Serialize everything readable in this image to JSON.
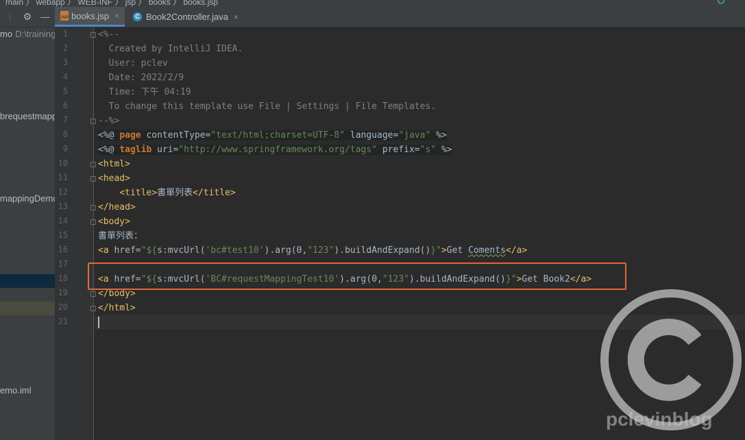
{
  "breadcrumb": [
    "main",
    "webapp",
    "WEB-INF",
    "jsp",
    "books",
    "books.jsp"
  ],
  "project_panel": {
    "items": [
      {
        "label": "mo",
        "path": "D:\\training"
      },
      {
        "label": "brequestmapp",
        "path": ""
      },
      {
        "label": "mappingDemo",
        "path": ""
      },
      {
        "label": "emo.iml",
        "path": ""
      }
    ]
  },
  "tabs": [
    {
      "label": "books.jsp",
      "icon": "jsp-file-icon",
      "active": true
    },
    {
      "label": "Book2Controller.java",
      "icon": "java-class-icon",
      "active": false
    }
  ],
  "tab_icons": {
    "jsp": "JSP",
    "class": "C"
  },
  "close_glyph": "×",
  "editor": {
    "caret_line": 21,
    "line_numbers": [
      "1",
      "2",
      "3",
      "4",
      "5",
      "6",
      "7",
      "8",
      "9",
      "10",
      "11",
      "12",
      "13",
      "14",
      "15",
      "16",
      "17",
      "18",
      "19",
      "20",
      "21"
    ],
    "lines": [
      [
        [
          "c",
          "<%--"
        ]
      ],
      [
        [
          "c",
          "  Created by IntelliJ IDEA."
        ]
      ],
      [
        [
          "c",
          "  User: pclev"
        ]
      ],
      [
        [
          "c",
          "  Date: 2022/2/9"
        ]
      ],
      [
        [
          "c",
          "  Time: 下午 04:19"
        ]
      ],
      [
        [
          "c",
          "  To change this template use File | Settings | File Templates."
        ]
      ],
      [
        [
          "c",
          "--%>"
        ]
      ],
      [
        [
          "dir",
          "<%@ "
        ],
        [
          "kwd",
          "page"
        ],
        [
          "dir",
          " contentType="
        ],
        [
          "str",
          "\"text/html;charset=UTF-8\""
        ],
        [
          "dir",
          " language="
        ],
        [
          "str",
          "\"java\""
        ],
        [
          "dir",
          " %>"
        ]
      ],
      [
        [
          "dir",
          "<%@ "
        ],
        [
          "kwd",
          "taglib"
        ],
        [
          "dir",
          " uri="
        ],
        [
          "str",
          "\"http://www.springframework.org/tags\""
        ],
        [
          "dir",
          " prefix="
        ],
        [
          "str",
          "\"s\""
        ],
        [
          "dir",
          " %>"
        ]
      ],
      [
        [
          "tag",
          "<html>"
        ]
      ],
      [
        [
          "tag",
          "<head>"
        ]
      ],
      [
        [
          "p",
          "    "
        ],
        [
          "tag",
          "<title>"
        ],
        [
          "p",
          "書單列表"
        ],
        [
          "tag",
          "</title>"
        ]
      ],
      [
        [
          "tag",
          "</head>"
        ]
      ],
      [
        [
          "tag",
          "<body>"
        ]
      ],
      [
        [
          "p",
          "書單列表："
        ]
      ],
      [
        [
          "tag",
          "<a "
        ],
        [
          "p",
          "href="
        ],
        [
          "str",
          "\"${"
        ],
        [
          "p",
          "s:mvcUrl("
        ],
        [
          "str",
          "'bc#test10'"
        ],
        [
          "p",
          ").arg(0,"
        ],
        [
          "str",
          "\"123\""
        ],
        [
          "p",
          ").buildAndExpand()"
        ],
        [
          "str",
          "}\""
        ],
        [
          "tag",
          ">"
        ],
        [
          "p",
          "Get "
        ],
        [
          "w",
          "Coments"
        ],
        [
          "tag",
          "</a>"
        ]
      ],
      [],
      [
        [
          "tag",
          "<a "
        ],
        [
          "p",
          "href="
        ],
        [
          "str",
          "\"${"
        ],
        [
          "p",
          "s:mvcUrl("
        ],
        [
          "str",
          "'BC#requestMappingTest10'"
        ],
        [
          "p",
          ").arg(0,"
        ],
        [
          "str",
          "\"123\""
        ],
        [
          "p",
          ").buildAndExpand()"
        ],
        [
          "str",
          "}\""
        ],
        [
          "tag",
          ">"
        ],
        [
          "p",
          "Get Book2"
        ],
        [
          "tag",
          "</a>"
        ]
      ],
      [
        [
          "tag",
          "</body>"
        ]
      ],
      [
        [
          "tag",
          "</html>"
        ]
      ],
      []
    ]
  },
  "watermark": {
    "text": "pclevinblog",
    "symbol": "©"
  }
}
